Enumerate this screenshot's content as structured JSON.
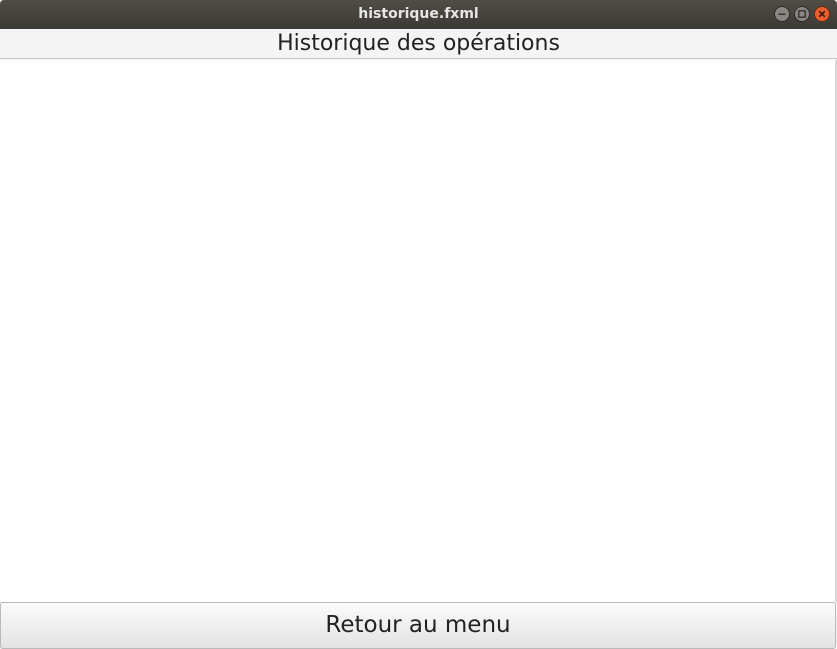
{
  "window": {
    "title": "historique.fxml",
    "controls": {
      "minimize": "minimize-icon",
      "maximize": "maximize-icon",
      "close": "close-icon"
    }
  },
  "page": {
    "title": "Historique des opérations"
  },
  "footer": {
    "back_label": "Retour au menu"
  },
  "colors": {
    "titlebar": "#3c3a36",
    "close_button": "#e9602f"
  }
}
